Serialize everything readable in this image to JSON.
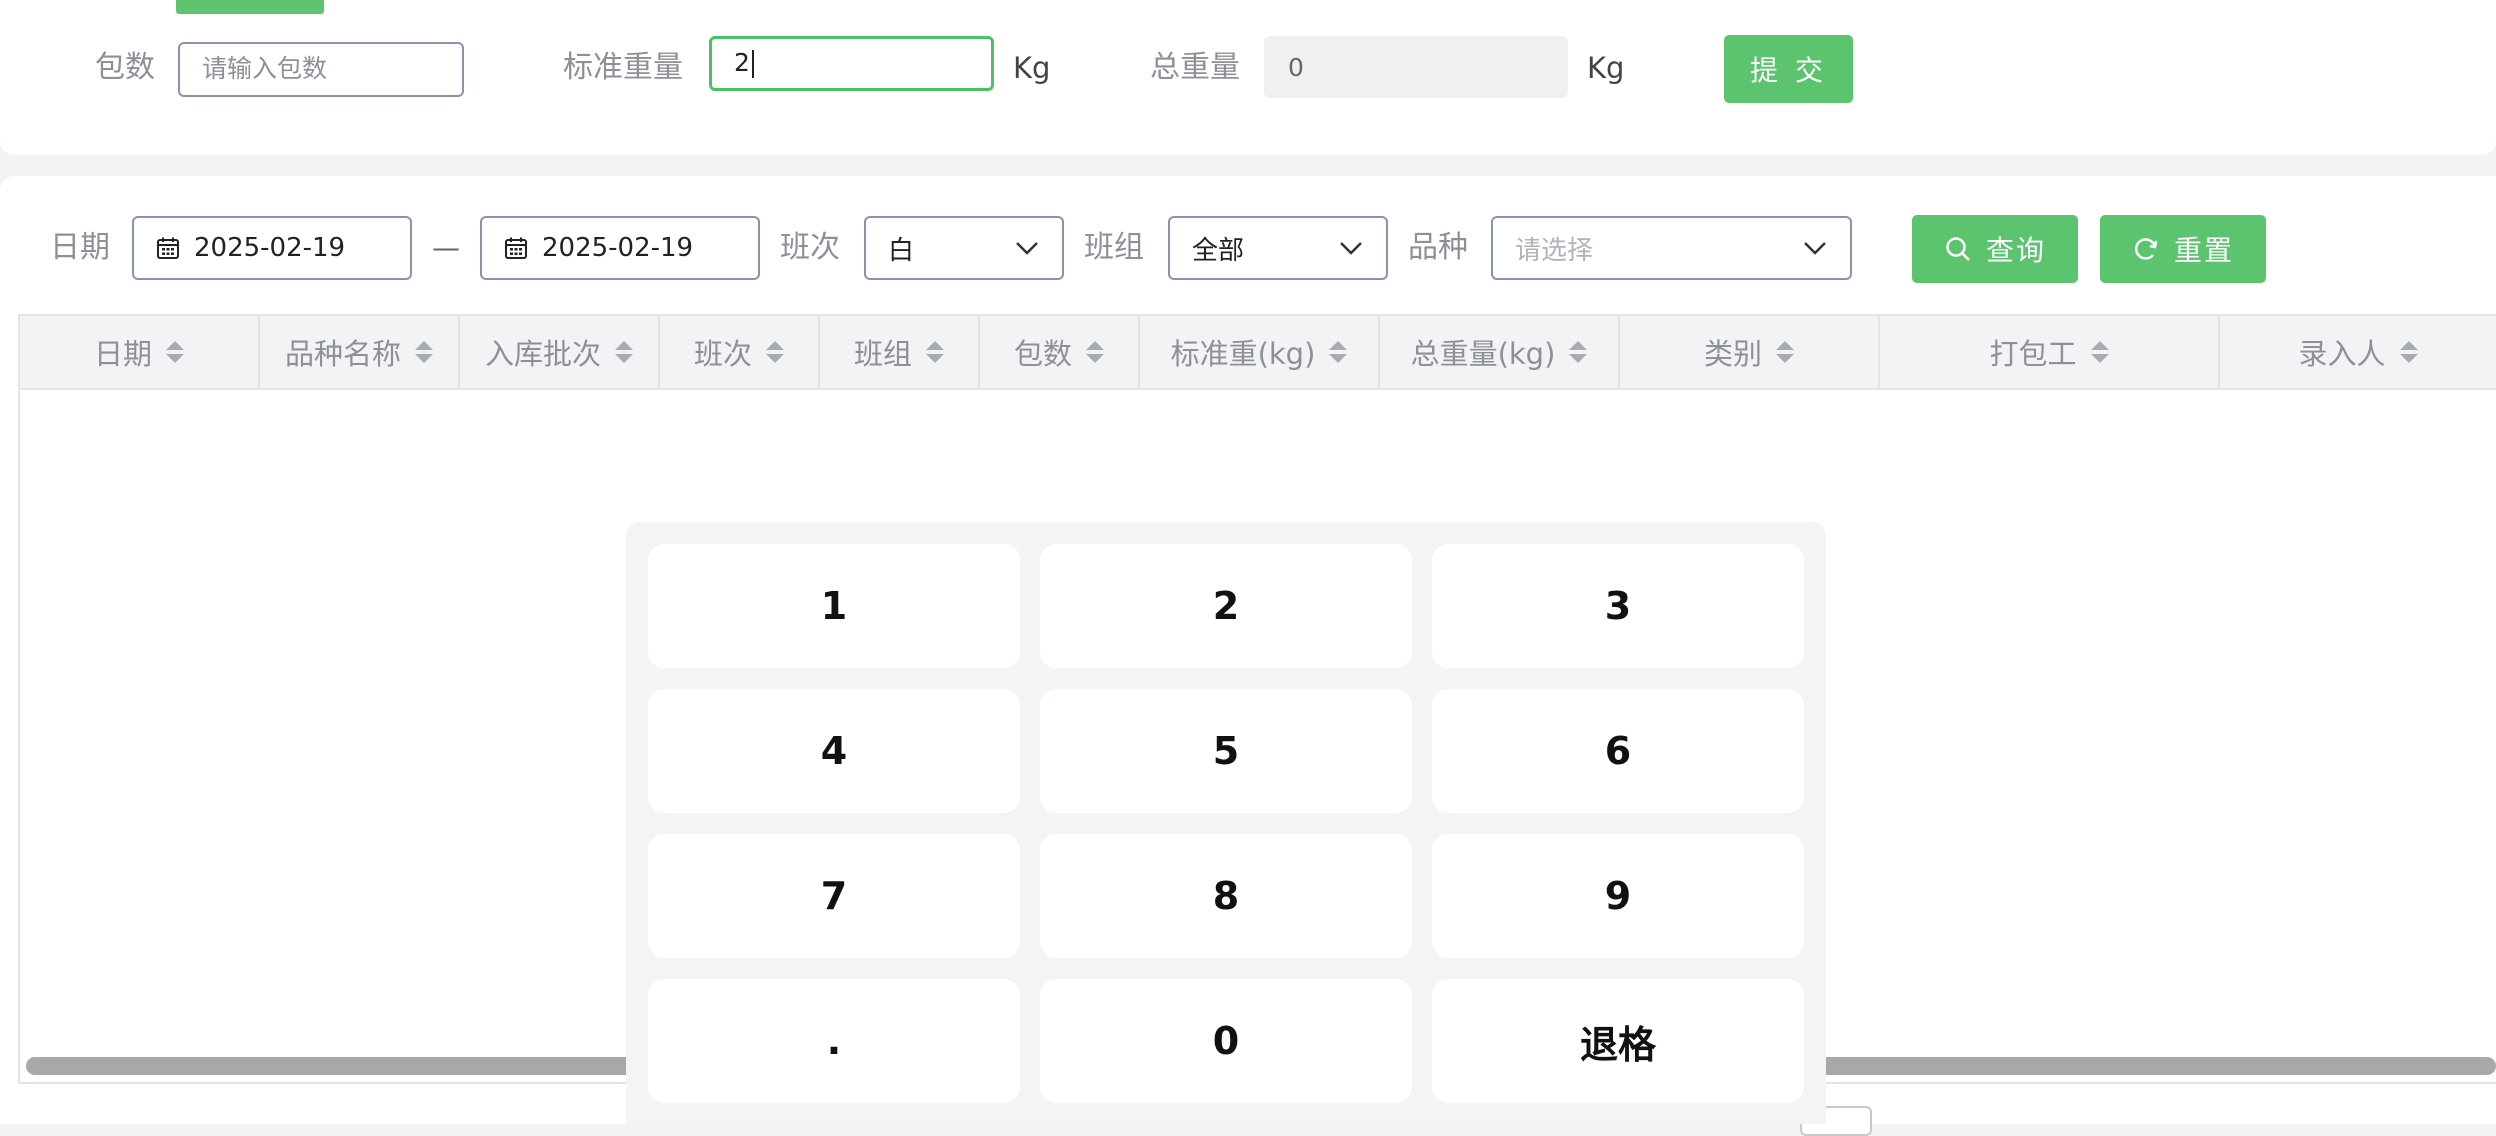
{
  "form": {
    "packages_label": "包数",
    "packages_placeholder": "请输入包数",
    "std_weight_label": "标准重量",
    "std_weight_value": "2",
    "std_weight_unit": "Kg",
    "total_weight_label": "总重量",
    "total_weight_value": "0",
    "total_weight_unit": "Kg",
    "submit_label": "提 交"
  },
  "filters": {
    "date_label": "日期",
    "date_start": "2025-02-19",
    "date_separator": "—",
    "date_end": "2025-02-19",
    "shift_label": "班次",
    "shift_value": "白",
    "team_label": "班组",
    "team_value": "全部",
    "variety_label": "品种",
    "variety_placeholder": "请选择",
    "query_label": "查询",
    "reset_label": "重置"
  },
  "table": {
    "columns": [
      "日期",
      "品种名称",
      "入库批次",
      "班次",
      "班组",
      "包数",
      "标准重(kg)",
      "总重量(kg)",
      "类别",
      "打包工",
      "录入人"
    ]
  },
  "keypad": {
    "keys": [
      "1",
      "2",
      "3",
      "4",
      "5",
      "6",
      "7",
      "8",
      "9",
      ".",
      "0",
      "退格"
    ]
  },
  "colors": {
    "accent_green": "#5cc46f",
    "focus_green": "#4fc165",
    "input_border": "#8a93ad",
    "label_gray": "#8e9099"
  }
}
